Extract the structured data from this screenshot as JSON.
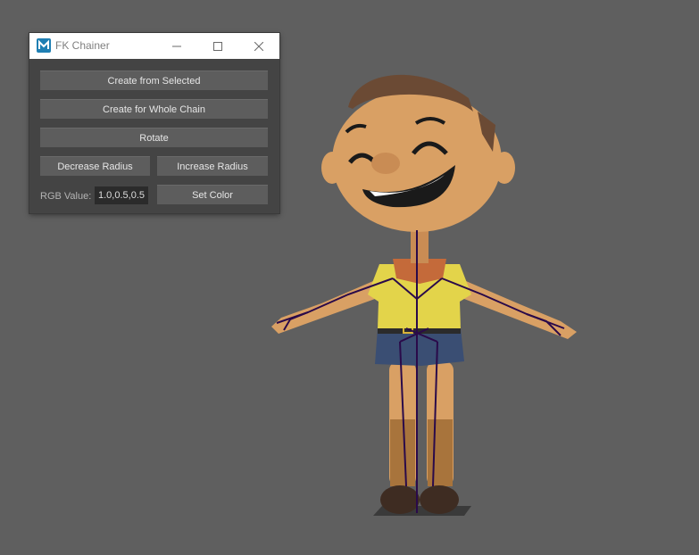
{
  "window": {
    "title": "FK Chainer",
    "app_icon": "maya-icon",
    "controls": [
      "minimize-icon",
      "maximize-icon",
      "close-icon"
    ]
  },
  "buttons": {
    "create_from_selected": "Create from Selected",
    "create_whole_chain": "Create for Whole Chain",
    "rotate": "Rotate",
    "decrease_radius": "Decrease Radius",
    "increase_radius": "Increase Radius",
    "set_color": "Set Color"
  },
  "rgb": {
    "label": "RGB Value:",
    "value": "1.0,0.5,0.5"
  },
  "colors": {
    "viewport_bg": "#5f5f5f",
    "panel_bg": "#444444",
    "button_bg": "#5d5d5d",
    "joint_color": "#2a0a4a"
  }
}
